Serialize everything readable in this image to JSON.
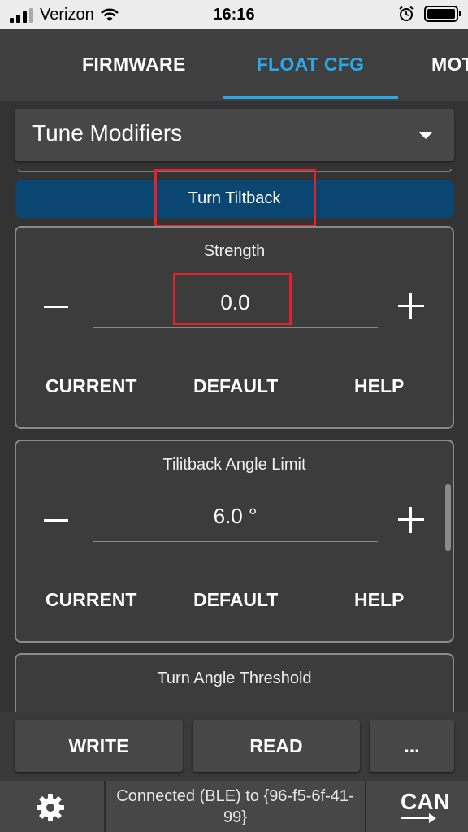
{
  "status_bar": {
    "carrier": "Verizon",
    "time": "16:16"
  },
  "tabs": [
    {
      "label": "FIRMWARE"
    },
    {
      "label": "FLOAT CFG",
      "active": true
    },
    {
      "label": "MOT"
    }
  ],
  "selector": {
    "label": "Tune Modifiers"
  },
  "section": {
    "title": "Turn Tiltback"
  },
  "params": [
    {
      "title": "Strength",
      "value": "0.0",
      "current": "CURRENT",
      "default": "DEFAULT",
      "help": "HELP"
    },
    {
      "title": "Tilitback Angle Limit",
      "value": "6.0 °",
      "current": "CURRENT",
      "default": "DEFAULT",
      "help": "HELP"
    },
    {
      "title": "Turn Angle Threshold"
    }
  ],
  "actions": {
    "write": "WRITE",
    "read": "READ",
    "more": "..."
  },
  "footer": {
    "connection": "Connected (BLE) to {96-f5-6f-41-99}",
    "can": "CAN"
  },
  "colors": {
    "accent": "#2ba8e8",
    "section_header": "#0b4572",
    "highlight": "#e3232c"
  }
}
